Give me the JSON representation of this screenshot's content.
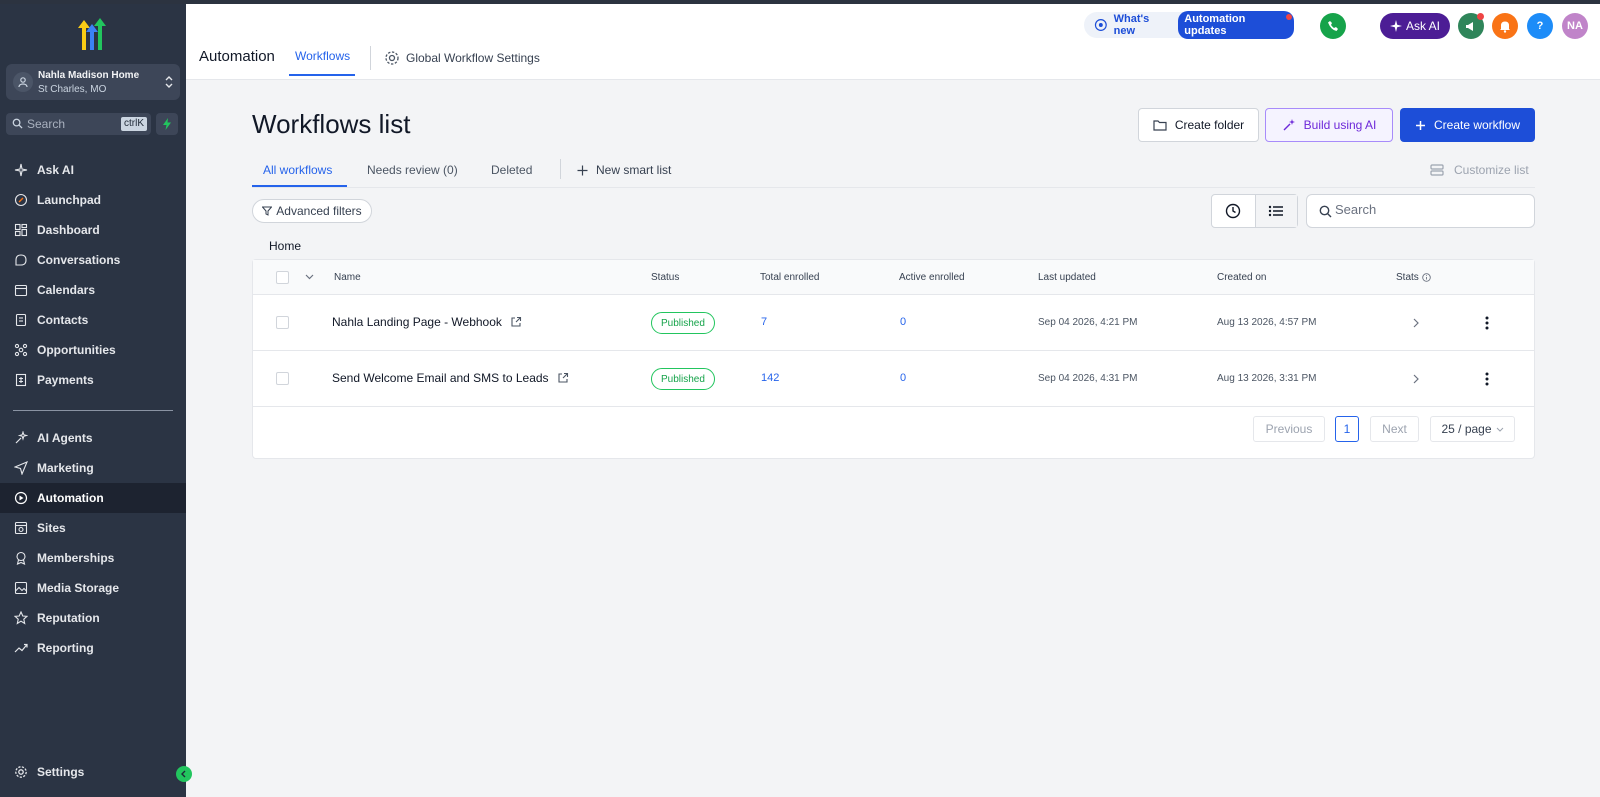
{
  "sidebar": {
    "location_name": "Nahla Madison Home",
    "location_city": "St Charles, MO",
    "search_placeholder": "Search",
    "search_shortcut": "ctrlK",
    "items_top": [
      {
        "label": "Ask AI",
        "icon": "sparkle-icon"
      },
      {
        "label": "Launchpad",
        "icon": "rocket-icon"
      },
      {
        "label": "Dashboard",
        "icon": "dashboard-icon"
      },
      {
        "label": "Conversations",
        "icon": "chat-icon"
      },
      {
        "label": "Calendars",
        "icon": "calendar-icon"
      },
      {
        "label": "Contacts",
        "icon": "contacts-icon"
      },
      {
        "label": "Opportunities",
        "icon": "opportunities-icon"
      },
      {
        "label": "Payments",
        "icon": "payments-icon"
      }
    ],
    "items_bottom": [
      {
        "label": "AI Agents",
        "icon": "ai-agents-icon"
      },
      {
        "label": "Marketing",
        "icon": "send-icon"
      },
      {
        "label": "Automation",
        "icon": "automation-icon",
        "active": true
      },
      {
        "label": "Sites",
        "icon": "sites-icon"
      },
      {
        "label": "Memberships",
        "icon": "award-icon"
      },
      {
        "label": "Media Storage",
        "icon": "image-icon"
      },
      {
        "label": "Reputation",
        "icon": "star-icon"
      },
      {
        "label": "Reporting",
        "icon": "trend-icon"
      }
    ],
    "settings_label": "Settings"
  },
  "header": {
    "title": "Automation",
    "tab_workflows": "Workflows",
    "global_settings": "Global Workflow Settings",
    "whats_new": "What's new",
    "automation_updates": "Automation updates",
    "ask_ai": "Ask AI",
    "avatar_initials": "NA",
    "help": "?"
  },
  "main": {
    "title": "Workflows list",
    "create_folder": "Create folder",
    "build_ai": "Build using AI",
    "create_workflow": "Create workflow",
    "tabs": {
      "all": "All workflows",
      "review": "Needs review (0)",
      "deleted": "Deleted"
    },
    "new_smart_list": "New smart list",
    "customize_list": "Customize list",
    "advanced_filters": "Advanced filters",
    "search_placeholder": "Search",
    "breadcrumb": "Home"
  },
  "table": {
    "columns": {
      "name": "Name",
      "status": "Status",
      "total": "Total enrolled",
      "active": "Active enrolled",
      "updated": "Last updated",
      "created": "Created on",
      "stats": "Stats"
    },
    "rows": [
      {
        "name": "Nahla Landing Page - Webhook",
        "status": "Published",
        "total": "7",
        "active": "0",
        "updated": "Sep 04 2026, 4:21 PM",
        "created": "Aug 13 2026, 4:57 PM"
      },
      {
        "name": "Send Welcome Email and SMS to Leads",
        "status": "Published",
        "total": "142",
        "active": "0",
        "updated": "Sep 04 2026, 4:31 PM",
        "created": "Aug 13 2026, 3:31 PM"
      }
    ]
  },
  "pagination": {
    "previous": "Previous",
    "page": "1",
    "next": "Next",
    "page_size": "25 / page"
  },
  "colors": {
    "sidebar_bg": "#2b3444",
    "primary": "#1d4ed8",
    "ai_purple": "#6d28d9",
    "published_green": "#16a34a"
  }
}
